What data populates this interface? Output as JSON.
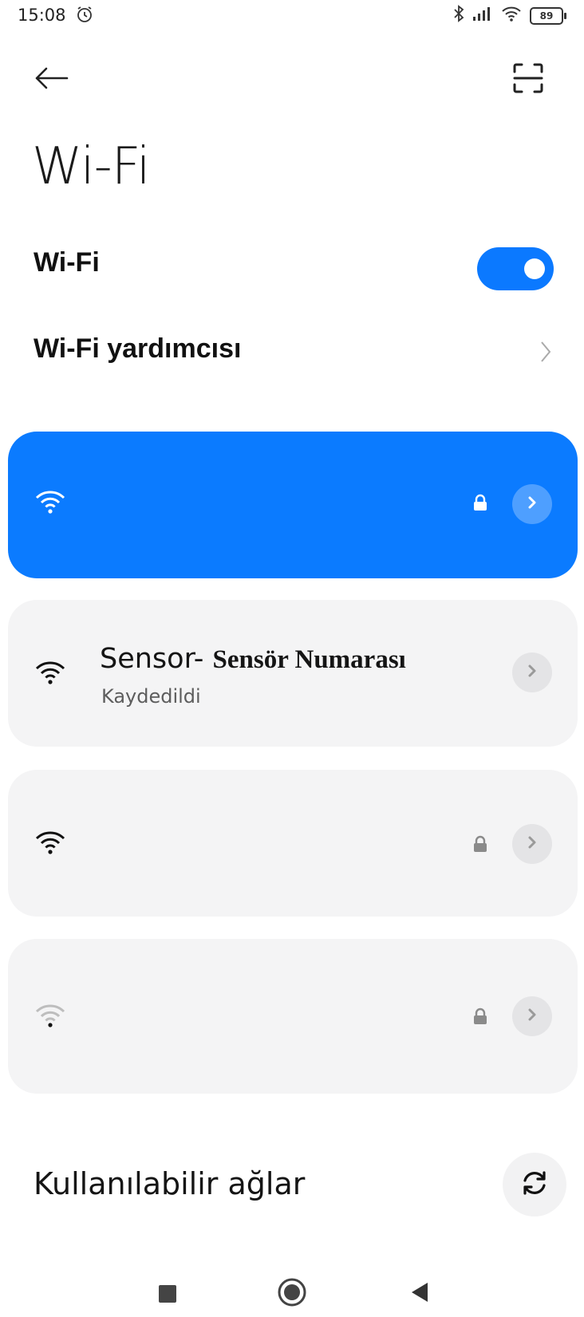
{
  "status_bar": {
    "time": "15:08",
    "battery": "89"
  },
  "header": {
    "title": "Wi-Fi"
  },
  "settings": {
    "wifi_label": "Wi-Fi",
    "wifi_enabled": true,
    "assistant_label": "Wi-Fi yardımcısı"
  },
  "networks": [
    {
      "name": "",
      "status": "",
      "connected": true,
      "locked": true,
      "signal": "full"
    },
    {
      "name_prefix": "Sensor- ",
      "name_bold": "Sensör Numarası",
      "status": "Kaydedildi",
      "connected": false,
      "locked": false,
      "signal": "full"
    },
    {
      "name": "",
      "status": "",
      "connected": false,
      "locked": true,
      "signal": "full"
    },
    {
      "name": "",
      "status": "",
      "connected": false,
      "locked": true,
      "signal": "weak"
    }
  ],
  "available": {
    "label": "Kullanılabilir ağlar"
  },
  "colors": {
    "accent": "#0b7bff",
    "card": "#f4f4f5"
  },
  "icons": [
    "alarm-icon",
    "bluetooth-icon",
    "cell-signal-icon",
    "wifi-icon",
    "battery-icon",
    "back-arrow-icon",
    "scan-qr-icon",
    "chevron-right-icon",
    "lock-icon",
    "refresh-icon",
    "recents-icon",
    "home-icon",
    "back-icon"
  ]
}
